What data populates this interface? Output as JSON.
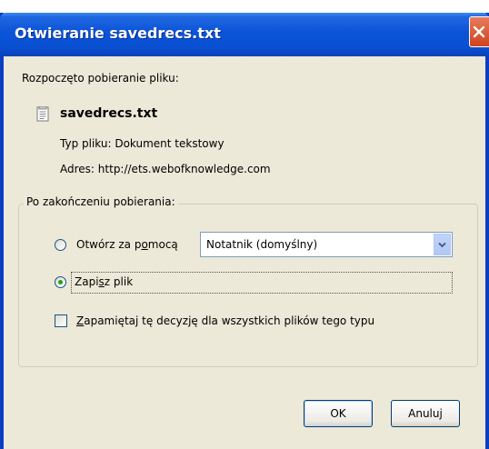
{
  "dialog": {
    "title": "Otwieranie savedrecs.txt",
    "started_label": "Rozpoczęto pobieranie pliku:",
    "file_name": "savedrecs.txt",
    "type_label": "Typ pliku:",
    "type_value": "Dokument tekstowy",
    "address_label": "Adres:",
    "address_value": "http://ets.webofknowledge.com",
    "group_title": "Po zakończeniu pobierania:",
    "open_with": {
      "pre": "Otwórz za p",
      "accel": "o",
      "post": "mocą",
      "selected": false
    },
    "app_select": {
      "value": "Notatnik (domyślny)"
    },
    "save_file": {
      "pre": "Zapi",
      "accel": "s",
      "post": "z plik",
      "selected": true
    },
    "remember": {
      "pre": "",
      "accel": "Z",
      "post": "apamiętaj tę decyzję dla wszystkich plików tego typu",
      "checked": false
    },
    "ok_label": "OK",
    "cancel_label": "Anuluj"
  },
  "background": {
    "fragment": "t"
  },
  "icons": {
    "close": "close-icon",
    "file": "text-file-icon",
    "dropdown": "chevron-down-icon"
  },
  "colors": {
    "titlebar": "#0a4fd2",
    "dialog_bg": "#ece9d8",
    "close": "#cf4320",
    "radio_dot": "#21a121"
  }
}
